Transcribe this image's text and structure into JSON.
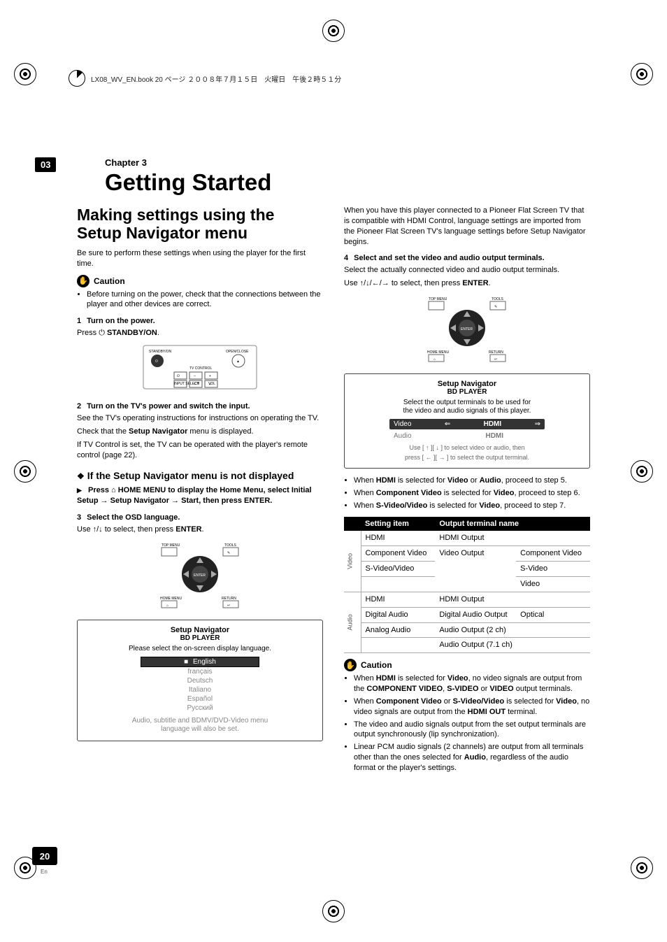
{
  "print_header": "LX08_WV_EN.book  20 ページ  ２００８年７月１５日　火曜日　午後２時５１分",
  "chapter_badge": "03",
  "chapter_label": "Chapter 3",
  "title": "Getting Started",
  "page_number": "20",
  "page_lang": "En",
  "left": {
    "h2": "Making settings using the Setup Navigator menu",
    "intro": "Be sure to perform these settings when using the player for the first time.",
    "caution_label": "Caution",
    "caution_bullet": "Before turning on the power, check that the connections between the player and other devices are correct.",
    "step1_num": "1",
    "step1_title": "Turn on the power.",
    "step1_body_a": "Press ",
    "step1_body_b": " STANDBY/ON",
    "step1_body_c": ".",
    "step2_num": "2",
    "step2_title": "Turn on the TV's power and switch the input.",
    "step2_body1": "See the TV's operating instructions for instructions on operating the TV.",
    "step2_body2a": "Check that the ",
    "step2_body2b": "Setup Navigator",
    "step2_body2c": " menu is displayed.",
    "step2_body3": "If TV Control is set, the TV can be operated with the player's remote control (page 22).",
    "sub_h": "If the Setup Navigator menu is not displayed",
    "sub_instr_a": "Press ",
    "sub_instr_b": " HOME MENU to display the Home Menu, select Initial Setup → Setup Navigator → Start, then press ENTER.",
    "step3_num": "3",
    "step3_title": "Select the OSD language.",
    "step3_body_a": "Use ",
    "step3_body_b": " to select, then press ",
    "step3_body_c": "ENTER",
    "step3_body_d": ".",
    "osd": {
      "title": "Setup Navigator",
      "sub": "BD PLAYER",
      "text": "Please select the on-screen display language.",
      "langs": [
        "English",
        "français",
        "Deutsch",
        "Italiano",
        "Español",
        "Русский"
      ],
      "foot1": "Audio, subtitle and BDMV/DVD-Video menu",
      "foot2": "language will also be set."
    },
    "remote1": {
      "standby": "STANDBY/ON",
      "open": "OPEN/CLOSE",
      "tvcontrol": "TV CONTROL",
      "input": "INPUT SELECT",
      "ch": "CH",
      "vol": "VOL"
    },
    "remote2": {
      "topmenu": "TOP MENU",
      "tools": "TOOLS",
      "enter": "ENTER",
      "home": "HOME MENU",
      "return": "RETURN"
    }
  },
  "right": {
    "intro": "When you have this player connected to a Pioneer Flat Screen TV that is compatible with HDMI Control, language settings are imported from the Pioneer Flat Screen TV's language settings before Setup Navigator begins.",
    "step4_num": "4",
    "step4_title": "Select and set the video and audio output terminals.",
    "step4_body": "Select the actually connected video and audio output terminals.",
    "step4_use_a": "Use ",
    "step4_use_b": " to select, then press ",
    "step4_use_c": "ENTER",
    "step4_use_d": ".",
    "osd": {
      "title": "Setup Navigator",
      "sub": "BD PLAYER",
      "text1": "Select the output terminals to be used for",
      "text2": "the video and audio signals of this player.",
      "row1_l": "Video",
      "row1_m": "HDMI",
      "row2_l": "Audio",
      "row2_m": "HDMI",
      "help1": "Use [ ↑ ][ ↓ ] to select video or audio, then",
      "help2": "press [ ← ][ → ] to select the output terminal."
    },
    "notes": [
      {
        "a": "When ",
        "b": "HDMI",
        "c": " is selected for ",
        "d": "Video",
        "e": " or ",
        "f": "Audio",
        "g": ", proceed to step 5."
      },
      {
        "a": "When ",
        "b": "Component Video",
        "c": " is selected for ",
        "d": "Video",
        "e": ", proceed to step 6.",
        "f": "",
        "g": ""
      },
      {
        "a": "When ",
        "b": "S-Video/Video",
        "c": " is selected for ",
        "d": "Video",
        "e": ", proceed to step 7.",
        "f": "",
        "g": ""
      }
    ],
    "table": {
      "th1": "Setting item",
      "th2": "Output terminal name",
      "v_label": "Video",
      "a_label": "Audio",
      "rows_video": [
        {
          "item": "HDMI",
          "out1": "HDMI Output",
          "out2": ""
        },
        {
          "item": "Component Video",
          "out1": "Video Output",
          "out2": "Component Video"
        },
        {
          "item": "S-Video/Video",
          "out1": "",
          "out2": "S-Video"
        },
        {
          "item": "",
          "out1": "",
          "out2": "Video"
        }
      ],
      "rows_audio": [
        {
          "item": "HDMI",
          "out1": "HDMI Output",
          "out2": ""
        },
        {
          "item": "Digital Audio",
          "out1": "Digital Audio Output",
          "out2": "Optical"
        },
        {
          "item": "Analog Audio",
          "out1": "Audio Output (2 ch)",
          "out2": ""
        },
        {
          "item": "",
          "out1": "Audio Output (7.1 ch)",
          "out2": ""
        }
      ]
    },
    "caution_label": "Caution",
    "cautions": [
      {
        "a": "When ",
        "b": "HDMI",
        "c": " is selected for ",
        "d": "Video",
        "e": ", no video signals are output from the ",
        "f": "COMPONENT VIDEO",
        "g": ", ",
        "h": "S-VIDEO",
        "i": " or ",
        "j": "VIDEO",
        "k": " output terminals."
      },
      {
        "a": "When ",
        "b": "Component Video",
        "c": " or ",
        "d": "S-Video/Video",
        "e": " is selected for ",
        "f": "Video",
        "g": ", no video signals are output from the ",
        "h": "HDMI OUT",
        "i": " terminal.",
        "j": "",
        "k": ""
      },
      {
        "a": "The video and audio signals output from the set output terminals are output synchronously (lip synchronization).",
        "b": "",
        "c": "",
        "d": "",
        "e": "",
        "f": "",
        "g": "",
        "h": "",
        "i": "",
        "j": "",
        "k": ""
      },
      {
        "a": "Linear PCM audio signals (2 channels) are output from all terminals other than the ones selected for ",
        "b": "Audio",
        "c": ", regardless of the audio format or the player's settings.",
        "d": "",
        "e": "",
        "f": "",
        "g": "",
        "h": "",
        "i": "",
        "j": "",
        "k": ""
      }
    ]
  }
}
